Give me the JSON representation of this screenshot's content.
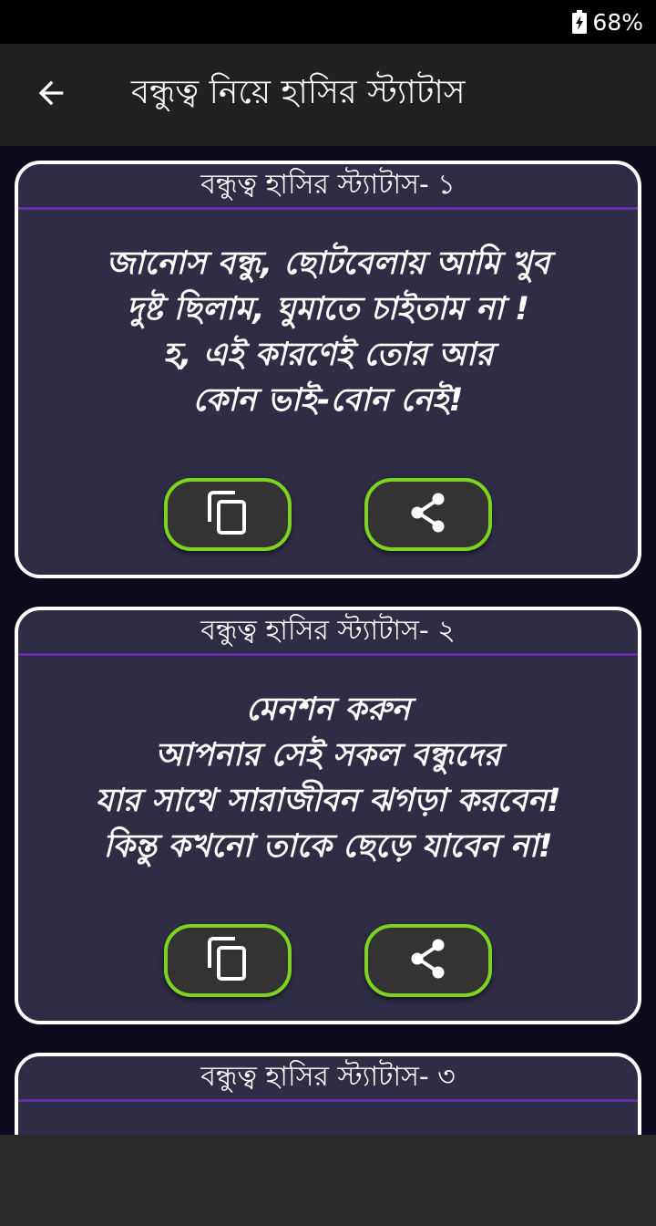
{
  "status_bar": {
    "battery_percent": "68%",
    "battery_icon": "battery-charging-icon"
  },
  "app_bar": {
    "title": "বন্ধুত্ব নিয়ে হাসির স্ট্যাটাস",
    "back_icon": "arrow-back-icon"
  },
  "cards": [
    {
      "header": "বন্ধুত্ব হাসির স্ট্যাটাস- ১",
      "lines": [
        "জানোস বন্ধু, ছোটবেলায় আমি খুব",
        "দুষ্ট ছিলাম, ঘুমাতে চাইতাম না !",
        "হ, এই কারণেই তোর আর",
        "কোন ভাই-বোন নেই!"
      ],
      "copy_icon": "copy-icon",
      "share_icon": "share-icon"
    },
    {
      "header": "বন্ধুত্ব হাসির স্ট্যাটাস- ২",
      "lines": [
        "মেনশন করুন",
        "আপনার সেই সকল বন্ধুদের",
        "যার সাথে সারাজীবন ঝগড়া করবেন!",
        "কিন্তু কখনো তাকে ছেড়ে যাবেন না!"
      ],
      "copy_icon": "copy-icon",
      "share_icon": "share-icon"
    },
    {
      "header": "বন্ধুত্ব হাসির স্ট্যাটাস- ৩",
      "lines": []
    }
  ],
  "colors": {
    "background": "#0b0b1c",
    "card": "#2f2d45",
    "card_border": "#ffffff",
    "header_divider": "#6a2ca8",
    "button_border": "#7ed321",
    "button_fill": "#333333",
    "app_bar": "#212121"
  }
}
